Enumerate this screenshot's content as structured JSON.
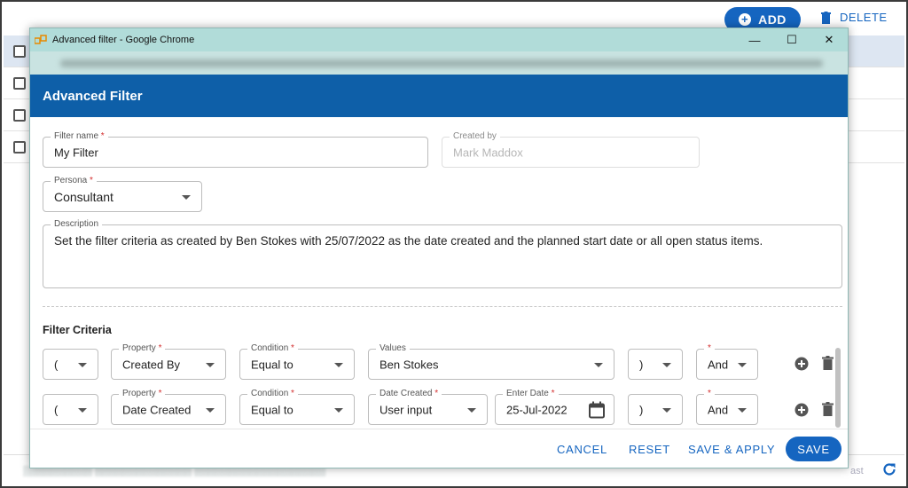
{
  "background": {
    "add_label": "ADD",
    "delete_label": "DELETE",
    "footer_last": "ast",
    "accent_color": "#1565c0"
  },
  "window": {
    "title": "Advanced filter - Google Chrome",
    "minimize": "—",
    "maximize": "☐",
    "close": "✕"
  },
  "dialog": {
    "header": "Advanced Filter",
    "header_color": "#0e5fa8",
    "filter_name": {
      "label": "Filter name",
      "value": "My Filter",
      "required": "*"
    },
    "created_by": {
      "label": "Created by",
      "value": "Mark Maddox"
    },
    "persona": {
      "label": "Persona",
      "value": "Consultant",
      "required": "*"
    },
    "description": {
      "label": "Description",
      "value": "Set the filter criteria as created by Ben Stokes with 25/07/2022 as the date created and the planned start date or all open status items."
    },
    "criteria_title": "Filter Criteria",
    "criteria": [
      {
        "open_paren": "(",
        "property_label": "Property",
        "property": "Created By",
        "condition_label": "Condition",
        "condition": "Equal to",
        "value_label": "Values",
        "value": "Ben Stokes",
        "close_paren": ")",
        "logic": "And",
        "required": "*"
      },
      {
        "open_paren": "(",
        "property_label": "Property",
        "property": "Date Created",
        "condition_label": "Condition",
        "condition": "Equal to",
        "value_label": "Date Created",
        "value": "User input",
        "date_label": "Enter Date",
        "date": "25-Jul-2022",
        "close_paren": ")",
        "logic": "And",
        "required": "*"
      }
    ],
    "actions": {
      "cancel": "CANCEL",
      "reset": "RESET",
      "save_apply": "SAVE & APPLY",
      "save": "SAVE"
    }
  }
}
